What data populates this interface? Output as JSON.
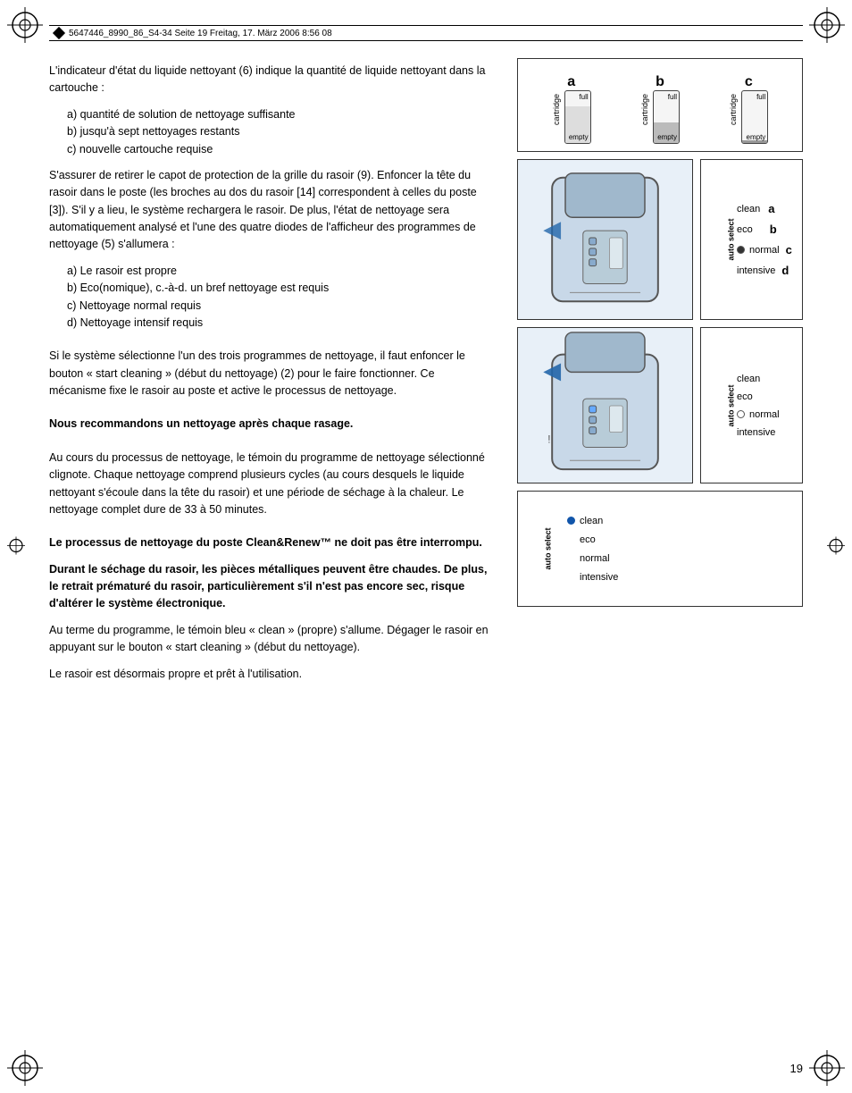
{
  "header": {
    "text": "5647446_8990_86_S4-34  Seite 19  Freitag, 17. März 2006  8:56 08"
  },
  "page_number": "19",
  "left_text": {
    "para1": "L'indicateur d'état du liquide nettoyant (6) indique la quantité de liquide nettoyant dans la cartouche :",
    "list1_a": "a)  quantité de solution de nettoyage suffisante",
    "list1_b": "b)  jusqu'à sept nettoyages restants",
    "list1_c": "c)  nouvelle cartouche requise",
    "para2": "S'assurer de retirer le capot de protection de la grille du rasoir (9). Enfoncer la tête du rasoir dans le poste (les broches au dos du rasoir [14] correspondent à celles du poste [3]). S'il y a lieu, le système rechargera le rasoir. De plus, l'état de nettoyage sera automatiquement analysé et l'une des quatre diodes de l'afficheur des programmes de nettoyage (5) s'allumera :",
    "list2_a": "a)  Le rasoir est propre",
    "list2_b": "b)  Eco(nomique), c.-à-d. un bref nettoyage est requis",
    "list2_c": "c)  Nettoyage normal requis",
    "list2_d": "d)  Nettoyage intensif requis",
    "para3": "Si le système sélectionne l'un des trois programmes de nettoyage, il faut enfoncer le bouton « start cleaning » (début du nettoyage) (2) pour le faire fonctionner. Ce mécanisme fixe le rasoir au poste et active le processus de nettoyage.",
    "bold1": "Nous recommandons un nettoyage après chaque rasage.",
    "para4": "Au cours du processus de nettoyage, le témoin du programme de nettoyage sélectionné clignote. Chaque nettoyage comprend plusieurs cycles (au cours desquels le liquide nettoyant s'écoule dans la tête du rasoir) et une période de séchage à la chaleur. Le nettoyage complet dure de 33 à 50 minutes.",
    "bold2": "Le processus de nettoyage du poste Clean&Renew™ ne doit pas être interrompu.",
    "bold3": "Durant le séchage du rasoir, les pièces métalliques peuvent être chaudes. De plus, le retrait prématuré du rasoir, particulièrement s'il n'est pas encore sec, risque d'altérer le système électronique.",
    "para5": "Au terme du programme, le témoin bleu « clean » (propre) s'allume. Dégager le rasoir en appuyant sur le bouton « start cleaning » (début du nettoyage).",
    "para6": "Le rasoir est désormais propre et prêt à l'utilisation."
  },
  "diagrams": {
    "cartridge": {
      "a_label": "a",
      "b_label": "b",
      "c_label": "c",
      "full": "full",
      "empty": "empty",
      "cartridge_text": "cartridge"
    },
    "select_options": {
      "auto_select": "auto select",
      "clean": "clean",
      "eco": "eco",
      "normal": "normal",
      "intensive": "intensive"
    },
    "letters": {
      "a": "a",
      "b": "b",
      "c": "c",
      "d": "d"
    }
  }
}
